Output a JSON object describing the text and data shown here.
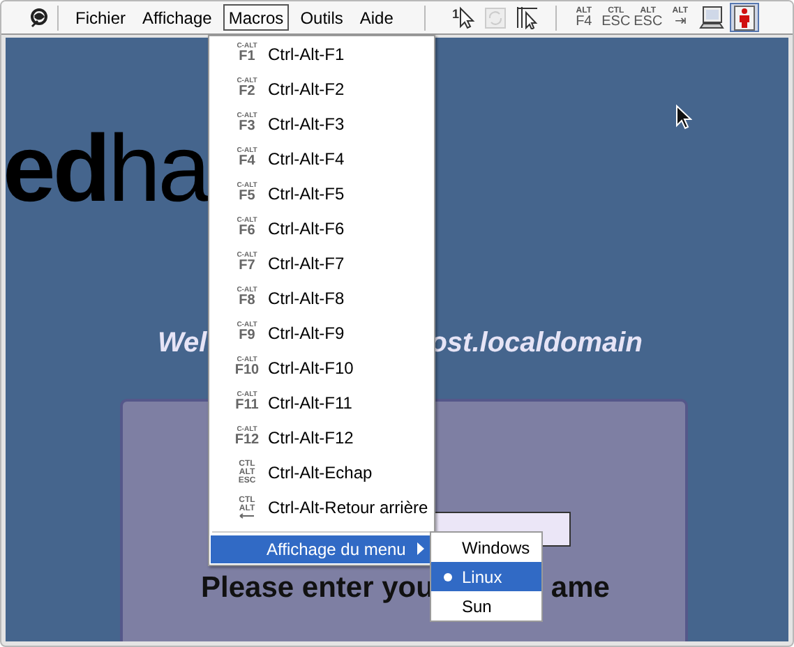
{
  "toolbar": {
    "menus": [
      {
        "label": "Fichier",
        "selected": false
      },
      {
        "label": "Affichage",
        "selected": false
      },
      {
        "label": "Macros",
        "selected": true
      },
      {
        "label": "Outils",
        "selected": false
      },
      {
        "label": "Aide",
        "selected": false
      }
    ],
    "tools": [
      {
        "kind": "numbered-pointer",
        "lines": [
          "1"
        ],
        "disabled": false,
        "pressed": false
      },
      {
        "kind": "refresh",
        "disabled": true,
        "pressed": false
      },
      {
        "kind": "pointer-lines",
        "disabled": false,
        "pressed": false
      },
      {
        "kind": "key",
        "lines": [
          "ALT",
          "F4"
        ],
        "disabled": false,
        "pressed": false
      },
      {
        "kind": "key",
        "lines": [
          "CTL",
          "ESC"
        ],
        "disabled": false,
        "pressed": false
      },
      {
        "kind": "key",
        "lines": [
          "ALT",
          "ESC"
        ],
        "disabled": false,
        "pressed": false
      },
      {
        "kind": "key",
        "lines": [
          "ALT",
          "⇥"
        ],
        "disabled": false,
        "pressed": false
      },
      {
        "kind": "monitor",
        "disabled": false,
        "pressed": false
      },
      {
        "kind": "person",
        "disabled": false,
        "pressed": true
      }
    ]
  },
  "desktop": {
    "logo": "**ed**ha",
    "welcome": [
      "Wel",
      "ost.localdomain"
    ],
    "prompt": [
      "Please enter you",
      "ame"
    ]
  },
  "macros_menu": {
    "items": [
      {
        "kind": "fkey",
        "icon": [
          "C-ALT",
          "F1"
        ],
        "label": "Ctrl-Alt-F1"
      },
      {
        "kind": "fkey",
        "icon": [
          "C-ALT",
          "F2"
        ],
        "label": "Ctrl-Alt-F2"
      },
      {
        "kind": "fkey",
        "icon": [
          "C-ALT",
          "F3"
        ],
        "label": "Ctrl-Alt-F3"
      },
      {
        "kind": "fkey",
        "icon": [
          "C-ALT",
          "F4"
        ],
        "label": "Ctrl-Alt-F4"
      },
      {
        "kind": "fkey",
        "icon": [
          "C-ALT",
          "F5"
        ],
        "label": "Ctrl-Alt-F5"
      },
      {
        "kind": "fkey",
        "icon": [
          "C-ALT",
          "F6"
        ],
        "label": "Ctrl-Alt-F6"
      },
      {
        "kind": "fkey",
        "icon": [
          "C-ALT",
          "F7"
        ],
        "label": "Ctrl-Alt-F7"
      },
      {
        "kind": "fkey",
        "icon": [
          "C-ALT",
          "F8"
        ],
        "label": "Ctrl-Alt-F8"
      },
      {
        "kind": "fkey",
        "icon": [
          "C-ALT",
          "F9"
        ],
        "label": "Ctrl-Alt-F9"
      },
      {
        "kind": "fkey",
        "icon": [
          "C-ALT",
          "F10"
        ],
        "label": "Ctrl-Alt-F10"
      },
      {
        "kind": "fkey",
        "icon": [
          "C-ALT",
          "F11"
        ],
        "label": "Ctrl-Alt-F11"
      },
      {
        "kind": "fkey",
        "icon": [
          "C-ALT",
          "F12"
        ],
        "label": "Ctrl-Alt-F12"
      },
      {
        "kind": "stack",
        "icon": [
          "CTL",
          "ALT",
          "ESC"
        ],
        "label": "Ctrl-Alt-Echap"
      },
      {
        "kind": "backspace",
        "icon": [
          "CTL",
          "ALT"
        ],
        "label": "Ctrl-Alt-Retour arrière"
      }
    ],
    "submenu": {
      "label": "Affichage du menu",
      "selected": true,
      "expanded": true,
      "options": [
        {
          "label": "Windows",
          "selected": false
        },
        {
          "label": "Linux",
          "selected": true
        },
        {
          "label": "Sun",
          "selected": false
        }
      ]
    }
  }
}
